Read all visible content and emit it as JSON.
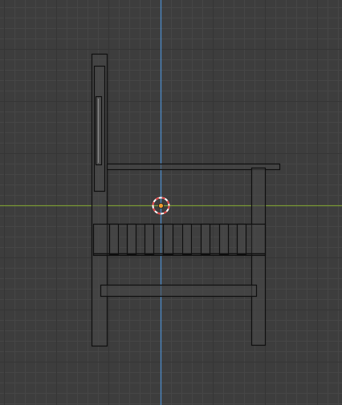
{
  "viewport": {
    "view": "side-orthographic",
    "background_color": "#3d3d3d",
    "grid_minor_color": "#464646",
    "grid_major_color": "#353535",
    "x_axis_color": "#7a9a34",
    "z_axis_color": "#4d8cc8",
    "mesh_fill_color": "#494949",
    "mesh_edge_color": "#0f0f0f",
    "cursor_color_a": "#e04545",
    "cursor_color_b": "#ffffff",
    "origin_color": "#f29a2e",
    "scene_object": "chair-wireframe",
    "cursor_icon": "3d-cursor-icon",
    "origin_icon": "object-origin-icon"
  }
}
